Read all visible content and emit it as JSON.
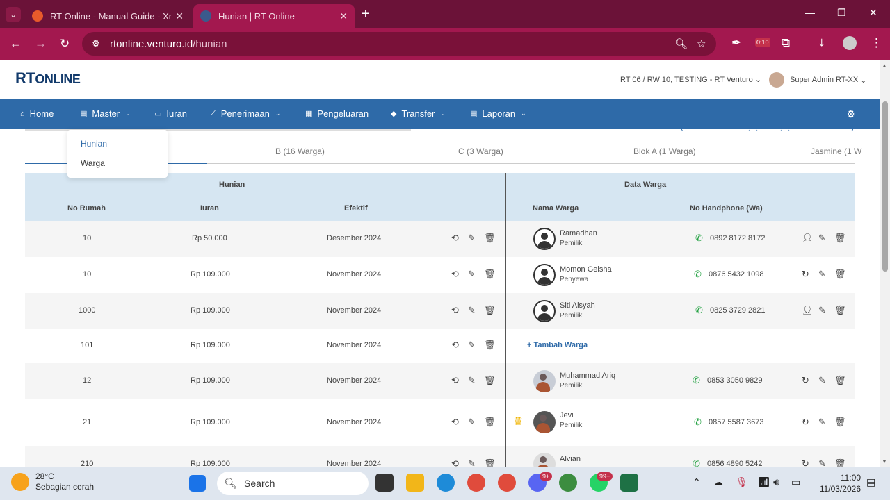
{
  "browser": {
    "tabs": [
      {
        "title": "RT Online - Manual Guide - Xm",
        "active": false
      },
      {
        "title": "Hunian | RT Online",
        "active": true
      }
    ],
    "url_host": "rtonline.venturo.id",
    "url_path": "/hunian",
    "extension_badge": "0:10"
  },
  "app": {
    "logo_text": "RT",
    "logo_text2": "ONLINE",
    "rt_info": "RT 06 / RW 10, TESTING - RT Venturo",
    "user_name": "Super Admin RT-XX",
    "nav": [
      {
        "label": "Home",
        "icon": "home-icon"
      },
      {
        "label": "Master",
        "icon": "document-icon",
        "dropdown": true
      },
      {
        "label": "Iuran",
        "icon": "card-icon"
      },
      {
        "label": "Penerimaan",
        "icon": "chart-icon",
        "dropdown": true
      },
      {
        "label": "Pengeluaran",
        "icon": "receipt-icon"
      },
      {
        "label": "Transfer",
        "icon": "tag-icon",
        "dropdown": true
      },
      {
        "label": "Laporan",
        "icon": "report-icon",
        "dropdown": true
      }
    ],
    "master_menu": [
      "Hunian",
      "Warga"
    ]
  },
  "subtabs": [
    "B (16 Warga)",
    "C (3 Warga)",
    "Blok A (1 Warga)",
    "Jasmine (1 W"
  ],
  "table": {
    "group_hunian": "Hunian",
    "group_warga": "Data Warga",
    "col_no_rumah": "No Rumah",
    "col_iuran": "Iuran",
    "col_efektif": "Efektif",
    "col_nama": "Nama Warga",
    "col_hp": "No Handphone (Wa)",
    "add_label": "Tambah Warga",
    "rows": [
      {
        "no": "10",
        "iuran": "Rp 50.000",
        "efektif": "Desember 2024",
        "nama": "Ramadhan",
        "role": "Pemilik",
        "hp": "0892 8172 8172"
      },
      {
        "no": "10",
        "iuran": "Rp 109.000",
        "efektif": "November 2024",
        "nama": "Momon Geisha",
        "role": "Penyewa",
        "hp": "0876 5432 1098"
      },
      {
        "no": "1000",
        "iuran": "Rp 109.000",
        "efektif": "November 2024",
        "nama": "Siti Aisyah",
        "role": "Pemilik",
        "hp": "0825 3729 2821"
      },
      {
        "no": "101",
        "iuran": "Rp 109.000",
        "efektif": "November 2024",
        "nama": "",
        "role": "",
        "hp": ""
      },
      {
        "no": "12",
        "iuran": "Rp 109.000",
        "efektif": "November 2024",
        "nama": "Muhammad Ariq",
        "role": "Pemilik",
        "hp": "0853 3050 9829"
      },
      {
        "no": "21",
        "iuran": "Rp 109.000",
        "efektif": "November 2024",
        "nama": "Jevi",
        "role": "Pemilik",
        "hp": "0857 5587 3673"
      },
      {
        "no": "210",
        "iuran": "Rp 109.000",
        "efektif": "November 2024",
        "nama": "Alvian",
        "role": "",
        "hp": "0856 4890 5242"
      }
    ]
  },
  "taskbar": {
    "temp": "28°C",
    "weather": "Sebagian cerah",
    "search": "Search",
    "time": "11:00",
    "date": "11/03/2026",
    "badge_discord": "9+",
    "badge_whatsapp": "99+"
  }
}
